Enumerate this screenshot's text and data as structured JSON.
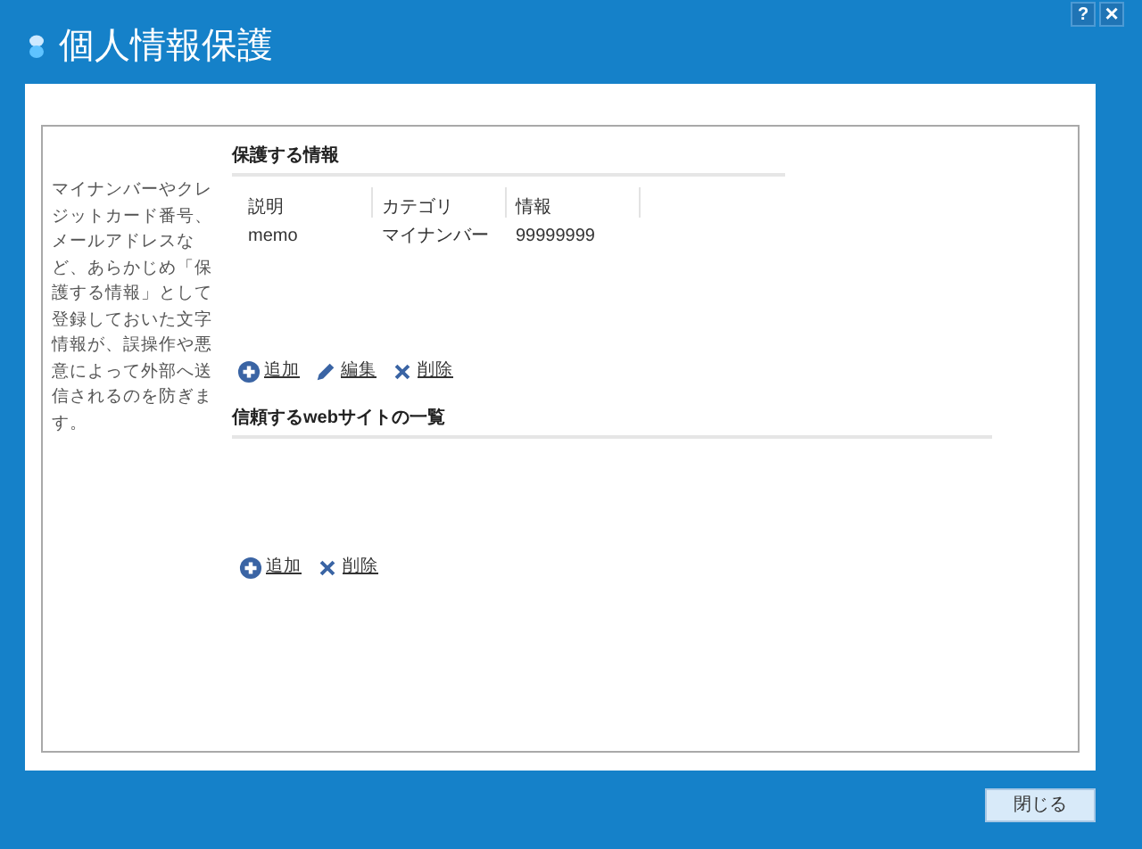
{
  "window": {
    "title": "個人情報保護",
    "buttons": [
      {
        "kind": "help",
        "label": "?"
      },
      {
        "kind": "close",
        "label": "×"
      }
    ]
  },
  "description": "マイナンバーやクレジットカード番号、メールアドレスなど、あらかじめ「保護する情報」として登録しておいた文字情報が、誤操作や悪意によって外部へ送信されるのを防ぎます。",
  "protected_info": {
    "title": "保護する情報",
    "columns": [
      "説明",
      "カテゴリ",
      "情報"
    ],
    "rows": [
      [
        "memo",
        "マイナンバー",
        "99999999"
      ]
    ],
    "actions": [
      {
        "kind": "add",
        "label": "追加"
      },
      {
        "kind": "edit",
        "label": "編集"
      },
      {
        "kind": "delete",
        "label": "削除"
      }
    ]
  },
  "trusted_sites": {
    "title": "信頼するwebサイトの一覧",
    "actions": [
      {
        "kind": "add",
        "label": "追加"
      },
      {
        "kind": "delete",
        "label": "削除"
      }
    ]
  },
  "footer": {
    "close_button": "閉じる"
  }
}
